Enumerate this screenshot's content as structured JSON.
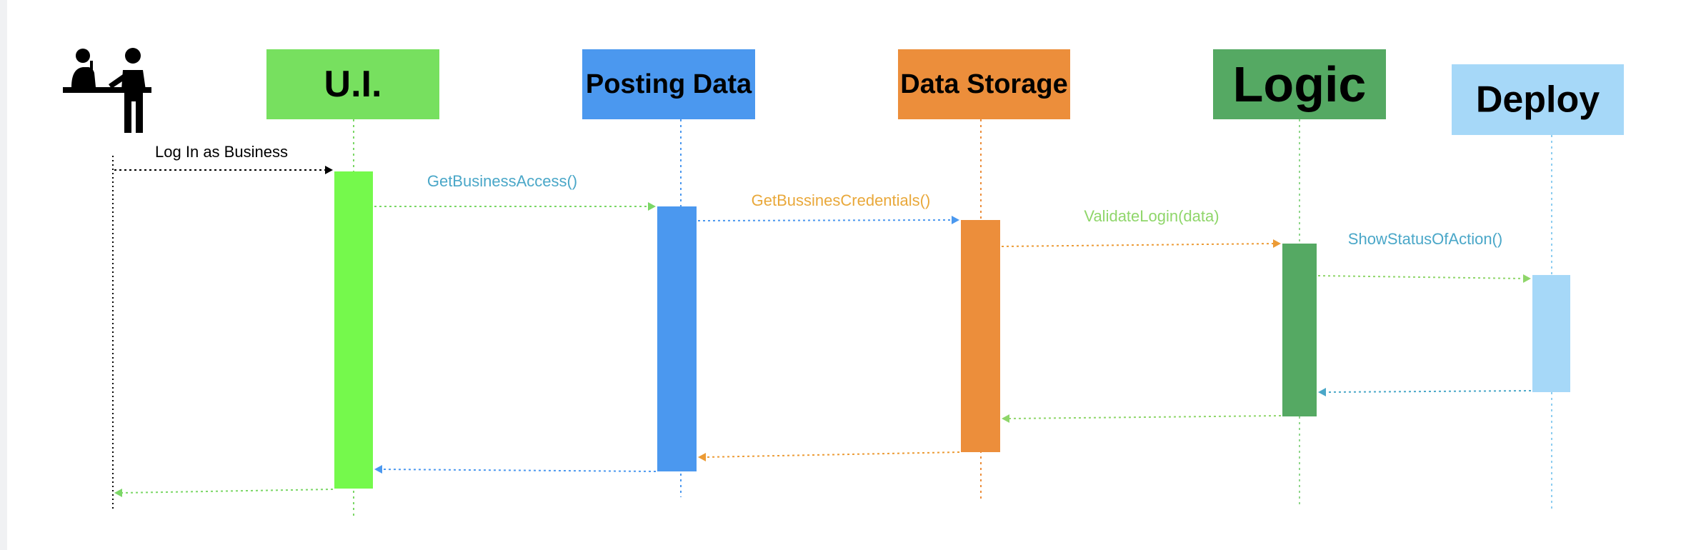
{
  "actor": {
    "icon": "business-actor-icon",
    "color": "#000000"
  },
  "lifelines": [
    {
      "id": "ui",
      "label": "U.I.",
      "color": "#77e05f",
      "bar_color": "#75f94c",
      "line_color": "#7bd766"
    },
    {
      "id": "posting",
      "label": "Posting Data",
      "color": "#4b98ef",
      "bar_color": "#4b98ef",
      "line_color": "#4b98ef"
    },
    {
      "id": "storage",
      "label": "Data Storage",
      "color": "#ec8e3b",
      "bar_color": "#ec8e3b",
      "line_color": "#ec8e3b"
    },
    {
      "id": "logic",
      "label": "Logic",
      "color": "#55a963",
      "bar_color": "#55a963",
      "line_color": "#8fd68a"
    },
    {
      "id": "deploy",
      "label": "Deploy",
      "color": "#a6d8f8",
      "bar_color": "#a6d8f8",
      "line_color": "#8ccdf0"
    }
  ],
  "messages": [
    {
      "id": "login",
      "label": "Log In as Business",
      "color": "#000000",
      "line_color": "#000000"
    },
    {
      "id": "get-access",
      "label": "GetBusinessAccess()",
      "color": "#4aa7c8",
      "line_color": "#7bd766"
    },
    {
      "id": "get-credentials",
      "label": "GetBussinesCredentials()",
      "color": "#e9a83a",
      "line_color": "#4b98ef"
    },
    {
      "id": "validate-login",
      "label": "ValidateLogin(data)",
      "color": "#8fd66a",
      "line_color": "#ec9b35"
    },
    {
      "id": "show-status",
      "label": "ShowStatusOfAction()",
      "color": "#4aa7c8",
      "line_color": "#8fd66a"
    }
  ],
  "returns": [
    {
      "id": "deploy-to-logic",
      "line_color": "#4aa7c8"
    },
    {
      "id": "logic-to-storage",
      "line_color": "#8fd66a"
    },
    {
      "id": "storage-to-posting",
      "line_color": "#ec9b35"
    },
    {
      "id": "posting-to-ui",
      "line_color": "#4b98ef"
    },
    {
      "id": "ui-to-actor",
      "line_color": "#7bd766"
    }
  ]
}
